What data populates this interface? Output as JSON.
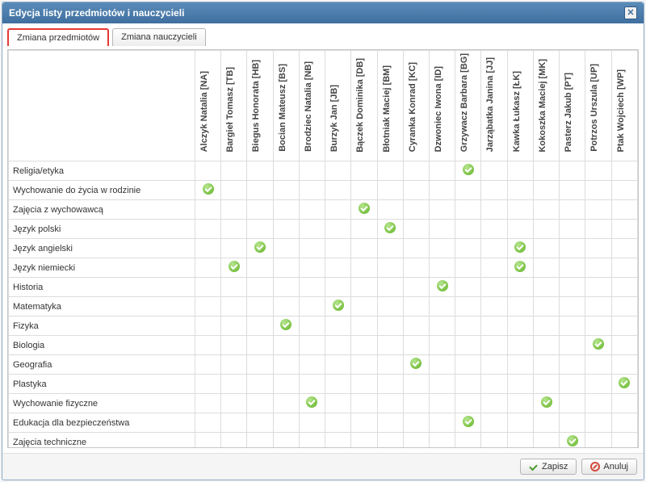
{
  "title": "Edycja listy przedmiotów i nauczycieli",
  "tabs": {
    "subjects": "Zmiana przedmiotów",
    "teachers": "Zmiana nauczycieli"
  },
  "teachers": [
    "Alczyk Natalia [NA]",
    "Bargieł Tomasz [TB]",
    "Biegus Honorata [HB]",
    "Bocian Mateusz [BS]",
    "Brodziec Natalia [NB]",
    "Burzyk Jan [JB]",
    "Bączek Dominika [DB]",
    "Błotniak Maciej [BM]",
    "Cyranka Konrad [KC]",
    "Dzwoniec Iwona [ID]",
    "Grzywacz Barbara [BG]",
    "Jarząbatka Janina [JJ]",
    "Kawka Łukasz [ŁK]",
    "Kokoszka Maciej [MK]",
    "Pasterz Jakub [PT]",
    "Potrzos Urszula [UP]",
    "Ptak Wojciech [WP]"
  ],
  "subjects": [
    "Religia/etyka",
    "Wychowanie do życia w rodzinie",
    "Zajęcia z wychowawcą",
    "Język polski",
    "Język angielski",
    "Język niemiecki",
    "Historia",
    "Matematyka",
    "Fizyka",
    "Biologia",
    "Geografia",
    "Plastyka",
    "Wychowanie fizyczne",
    "Edukacja dla bezpieczeństwa",
    "Zajęcia techniczne"
  ],
  "assignments": [
    [
      10
    ],
    [
      0
    ],
    [
      6
    ],
    [
      7
    ],
    [
      2,
      12
    ],
    [
      1,
      12
    ],
    [
      9
    ],
    [
      5
    ],
    [
      3
    ],
    [
      15
    ],
    [
      8
    ],
    [
      16
    ],
    [
      4,
      13
    ],
    [
      10
    ],
    [
      14
    ]
  ],
  "buttons": {
    "save": "Zapisz",
    "cancel": "Anuluj"
  }
}
